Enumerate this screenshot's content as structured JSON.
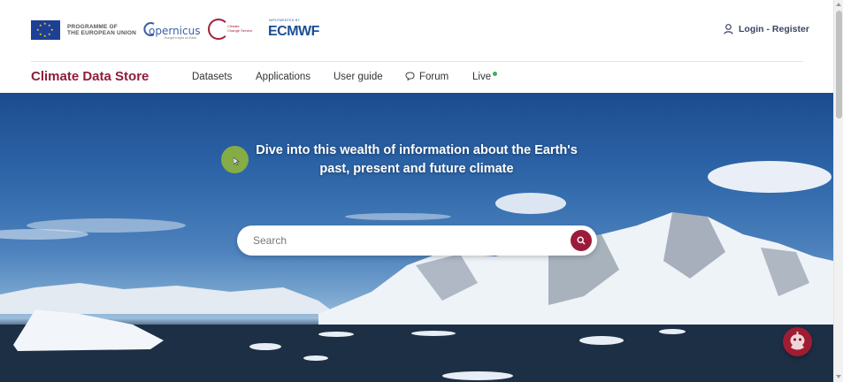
{
  "header": {
    "eu_text_line1": "PROGRAMME OF",
    "eu_text_line2": "THE EUROPEAN UNION",
    "copernicus_word": "opernicus",
    "copernicus_tag": "Europe's eyes on Earth",
    "ccs_line1": "Climate",
    "ccs_line2": "Change Service",
    "ecmwf_implemented": "IMPLEMENTED BY",
    "ecmwf_logo": "ECMWF",
    "login_label": "Login - Register"
  },
  "nav": {
    "brand": "Climate Data Store",
    "items": [
      {
        "label": "Datasets"
      },
      {
        "label": "Applications"
      },
      {
        "label": "User guide"
      },
      {
        "label": "Forum"
      },
      {
        "label": "Live"
      }
    ]
  },
  "hero": {
    "headline_line1": "Dive into this wealth of information about the Earth's",
    "headline_line2": "past, present and future climate"
  },
  "search": {
    "placeholder": "Search"
  },
  "colors": {
    "brand": "#8e1d38",
    "accent": "#9b1b3a",
    "live_indicator": "#3aaf5a"
  },
  "icons": {
    "login": "user-icon",
    "forum": "chat-bubble-icon",
    "search": "magnifier-icon",
    "assistant": "chatbot-icon"
  }
}
